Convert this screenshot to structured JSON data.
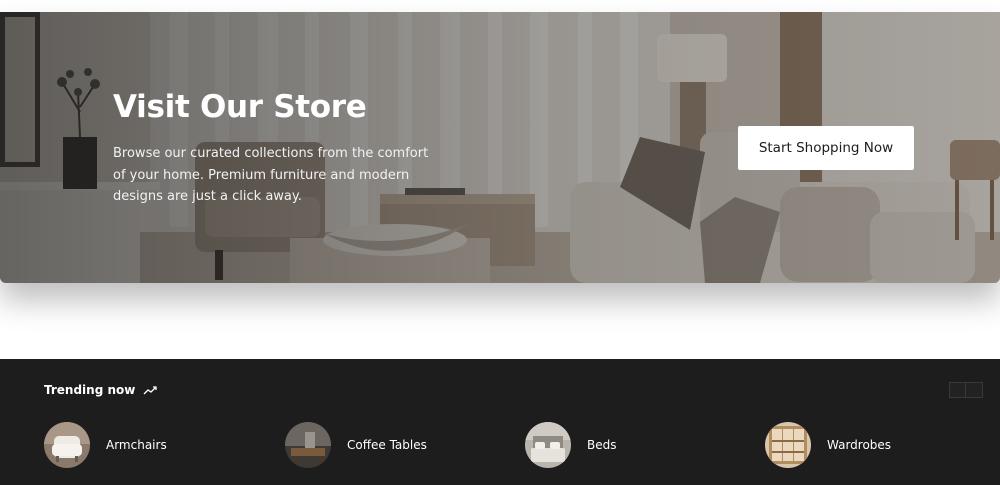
{
  "hero": {
    "title": "Visit Our Store",
    "description": "Browse our curated collections from the comfort of your home. Premium furniture and modern designs are just a click away.",
    "cta_label": "Start Shopping Now",
    "image": "living-room-photo"
  },
  "trending": {
    "title": "Trending now",
    "title_icon": "trending-up-icon",
    "nav_icons": [
      "arrow-left-icon",
      "arrow-right-icon"
    ],
    "items": [
      {
        "label": "Armchairs",
        "thumb": "armchair-thumbnail"
      },
      {
        "label": "Coffee Tables",
        "thumb": "coffee-table-thumbnail"
      },
      {
        "label": "Beds",
        "thumb": "bed-thumbnail"
      },
      {
        "label": "Wardrobes",
        "thumb": "wardrobe-thumbnail"
      }
    ]
  },
  "colors": {
    "trending_background": "#1e1d1d",
    "cta_background": "#ffffff",
    "text_light": "#ffffff"
  }
}
